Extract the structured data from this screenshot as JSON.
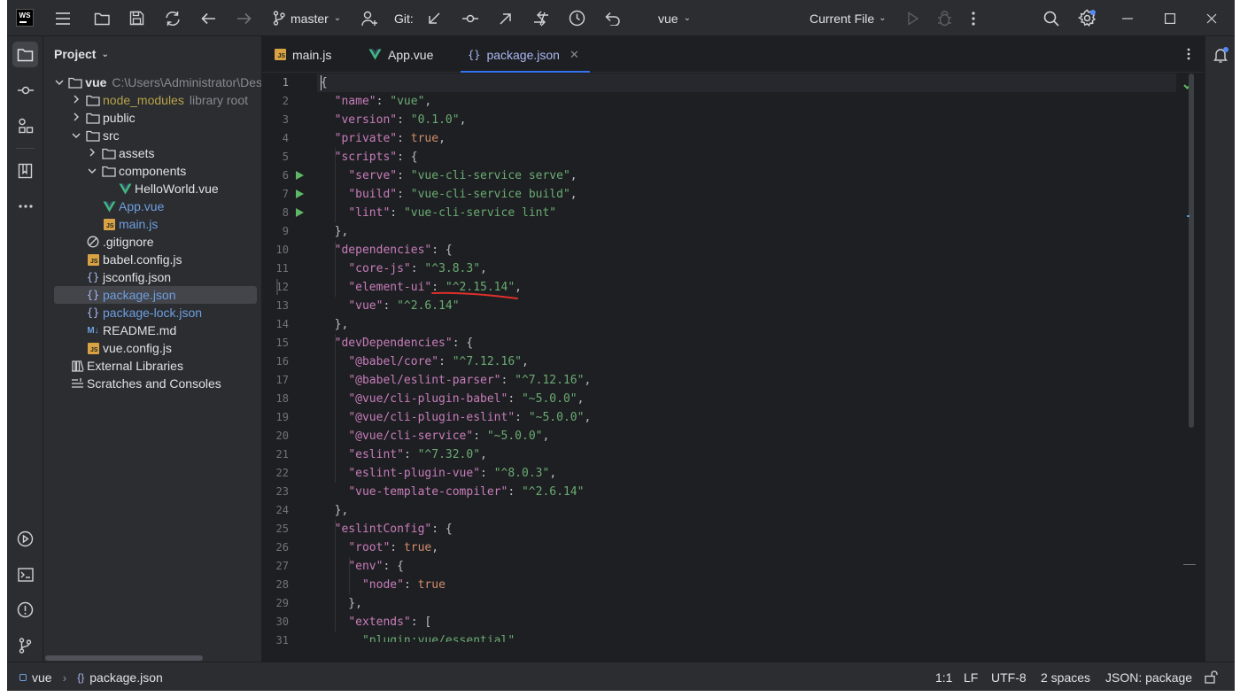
{
  "titlebar": {
    "logo": "WS",
    "branch": "master",
    "git_label": "Git:",
    "project_name": "vue",
    "run_config": "Current File"
  },
  "project_panel": {
    "title": "Project",
    "tree": [
      {
        "label": "vue",
        "hint": "C:\\Users\\Administrator\\Des",
        "depth": 0,
        "chevron": "down",
        "icon": "folder-icon"
      },
      {
        "label": "node_modules",
        "hint": "library root",
        "depth": 1,
        "chevron": "right",
        "icon": "folder-icon",
        "color": "yellow"
      },
      {
        "label": "public",
        "depth": 1,
        "chevron": "right",
        "icon": "folder-icon"
      },
      {
        "label": "src",
        "depth": 1,
        "chevron": "down",
        "icon": "folder-icon"
      },
      {
        "label": "assets",
        "depth": 2,
        "chevron": "right",
        "icon": "folder-icon"
      },
      {
        "label": "components",
        "depth": 2,
        "chevron": "down",
        "icon": "folder-icon"
      },
      {
        "label": "HelloWorld.vue",
        "depth": 3,
        "icon": "vue-icon"
      },
      {
        "label": "App.vue",
        "depth": 2,
        "icon": "vue-icon",
        "color": "blue"
      },
      {
        "label": "main.js",
        "depth": 2,
        "icon": "js-icon",
        "color": "blue"
      },
      {
        "label": ".gitignore",
        "depth": 1,
        "icon": "ignore-icon"
      },
      {
        "label": "babel.config.js",
        "depth": 1,
        "icon": "js-icon"
      },
      {
        "label": "jsconfig.json",
        "depth": 1,
        "icon": "json-icon"
      },
      {
        "label": "package.json",
        "depth": 1,
        "icon": "json-icon",
        "color": "blue",
        "selected": true
      },
      {
        "label": "package-lock.json",
        "depth": 1,
        "icon": "json-icon",
        "color": "blue"
      },
      {
        "label": "README.md",
        "depth": 1,
        "icon": "markdown-icon"
      },
      {
        "label": "vue.config.js",
        "depth": 1,
        "icon": "js-icon"
      },
      {
        "label": "External Libraries",
        "depth": 0,
        "icon": "library-icon"
      },
      {
        "label": "Scratches and Consoles",
        "depth": 0,
        "icon": "scratches-icon"
      }
    ]
  },
  "tabs": [
    {
      "label": "main.js",
      "icon": "js-icon"
    },
    {
      "label": "App.vue",
      "icon": "vue-icon"
    },
    {
      "label": "package.json",
      "icon": "json-icon",
      "active": true
    }
  ],
  "code_lines": [
    [
      [
        "p",
        "{"
      ]
    ],
    [
      [
        "p",
        "  "
      ],
      [
        "k",
        "\"name\""
      ],
      [
        "p",
        ": "
      ],
      [
        "s",
        "\"vue\""
      ],
      [
        "p",
        ","
      ]
    ],
    [
      [
        "p",
        "  "
      ],
      [
        "k",
        "\"version\""
      ],
      [
        "p",
        ": "
      ],
      [
        "s",
        "\"0.1.0\""
      ],
      [
        "p",
        ","
      ]
    ],
    [
      [
        "p",
        "  "
      ],
      [
        "k",
        "\"private\""
      ],
      [
        "p",
        ": "
      ],
      [
        "kw",
        "true"
      ],
      [
        "p",
        ","
      ]
    ],
    [
      [
        "p",
        "  "
      ],
      [
        "k",
        "\"scripts\""
      ],
      [
        "p",
        ": {"
      ]
    ],
    [
      [
        "p",
        "    "
      ],
      [
        "k",
        "\"serve\""
      ],
      [
        "p",
        ": "
      ],
      [
        "s",
        "\"vue-cli-service serve\""
      ],
      [
        "p",
        ","
      ]
    ],
    [
      [
        "p",
        "    "
      ],
      [
        "k",
        "\"build\""
      ],
      [
        "p",
        ": "
      ],
      [
        "s",
        "\"vue-cli-service build\""
      ],
      [
        "p",
        ","
      ]
    ],
    [
      [
        "p",
        "    "
      ],
      [
        "k",
        "\"lint\""
      ],
      [
        "p",
        ": "
      ],
      [
        "s",
        "\"vue-cli-service lint\""
      ]
    ],
    [
      [
        "p",
        "  },"
      ]
    ],
    [
      [
        "p",
        "  "
      ],
      [
        "k",
        "\"dependencies\""
      ],
      [
        "p",
        ": {"
      ]
    ],
    [
      [
        "p",
        "    "
      ],
      [
        "k",
        "\"core-js\""
      ],
      [
        "p",
        ": "
      ],
      [
        "s",
        "\"^3.8.3\""
      ],
      [
        "p",
        ","
      ]
    ],
    [
      [
        "p",
        "    "
      ],
      [
        "k",
        "\"element-ui\""
      ],
      [
        "p",
        ": "
      ],
      [
        "s",
        "\"^2.15.14\""
      ],
      [
        "p",
        ","
      ]
    ],
    [
      [
        "p",
        "    "
      ],
      [
        "k",
        "\"vue\""
      ],
      [
        "p",
        ": "
      ],
      [
        "s",
        "\"^2.6.14\""
      ]
    ],
    [
      [
        "p",
        "  },"
      ]
    ],
    [
      [
        "p",
        "  "
      ],
      [
        "k",
        "\"devDependencies\""
      ],
      [
        "p",
        ": {"
      ]
    ],
    [
      [
        "p",
        "    "
      ],
      [
        "k",
        "\"@babel/core\""
      ],
      [
        "p",
        ": "
      ],
      [
        "s",
        "\"^7.12.16\""
      ],
      [
        "p",
        ","
      ]
    ],
    [
      [
        "p",
        "    "
      ],
      [
        "k",
        "\"@babel/eslint-parser\""
      ],
      [
        "p",
        ": "
      ],
      [
        "s",
        "\"^7.12.16\""
      ],
      [
        "p",
        ","
      ]
    ],
    [
      [
        "p",
        "    "
      ],
      [
        "k",
        "\"@vue/cli-plugin-babel\""
      ],
      [
        "p",
        ": "
      ],
      [
        "s",
        "\"~5.0.0\""
      ],
      [
        "p",
        ","
      ]
    ],
    [
      [
        "p",
        "    "
      ],
      [
        "k",
        "\"@vue/cli-plugin-eslint\""
      ],
      [
        "p",
        ": "
      ],
      [
        "s",
        "\"~5.0.0\""
      ],
      [
        "p",
        ","
      ]
    ],
    [
      [
        "p",
        "    "
      ],
      [
        "k",
        "\"@vue/cli-service\""
      ],
      [
        "p",
        ": "
      ],
      [
        "s",
        "\"~5.0.0\""
      ],
      [
        "p",
        ","
      ]
    ],
    [
      [
        "p",
        "    "
      ],
      [
        "k",
        "\"eslint\""
      ],
      [
        "p",
        ": "
      ],
      [
        "s",
        "\"^7.32.0\""
      ],
      [
        "p",
        ","
      ]
    ],
    [
      [
        "p",
        "    "
      ],
      [
        "k",
        "\"eslint-plugin-vue\""
      ],
      [
        "p",
        ": "
      ],
      [
        "s",
        "\"^8.0.3\""
      ],
      [
        "p",
        ","
      ]
    ],
    [
      [
        "p",
        "    "
      ],
      [
        "k",
        "\"vue-template-compiler\""
      ],
      [
        "p",
        ": "
      ],
      [
        "s",
        "\"^2.6.14\""
      ]
    ],
    [
      [
        "p",
        "  },"
      ]
    ],
    [
      [
        "p",
        "  "
      ],
      [
        "k",
        "\"eslintConfig\""
      ],
      [
        "p",
        ": {"
      ]
    ],
    [
      [
        "p",
        "    "
      ],
      [
        "k",
        "\"root\""
      ],
      [
        "p",
        ": "
      ],
      [
        "kw",
        "true"
      ],
      [
        "p",
        ","
      ]
    ],
    [
      [
        "p",
        "    "
      ],
      [
        "k",
        "\"env\""
      ],
      [
        "p",
        ": {"
      ]
    ],
    [
      [
        "p",
        "      "
      ],
      [
        "k",
        "\"node\""
      ],
      [
        "p",
        ": "
      ],
      [
        "kw",
        "true"
      ]
    ],
    [
      [
        "p",
        "    },"
      ]
    ],
    [
      [
        "p",
        "    "
      ],
      [
        "k",
        "\"extends\""
      ],
      [
        "p",
        ": ["
      ]
    ],
    [
      [
        "p",
        "      "
      ],
      [
        "s",
        "\"plugin:vue/essential\""
      ],
      [
        "p",
        ","
      ]
    ]
  ],
  "run_gutter_lines": [
    6,
    7,
    8
  ],
  "statusbar": {
    "breadcrumb_project": "vue",
    "breadcrumb_file": "package.json",
    "position": "1:1",
    "line_sep": "LF",
    "encoding": "UTF-8",
    "indent": "2 spaces",
    "schema": "JSON: package"
  },
  "colors": {
    "accent": "#3574f0",
    "key": "#c77dbb",
    "string": "#6aab73",
    "keyword": "#cf8e6d",
    "annotation_red": "#e0302a"
  }
}
